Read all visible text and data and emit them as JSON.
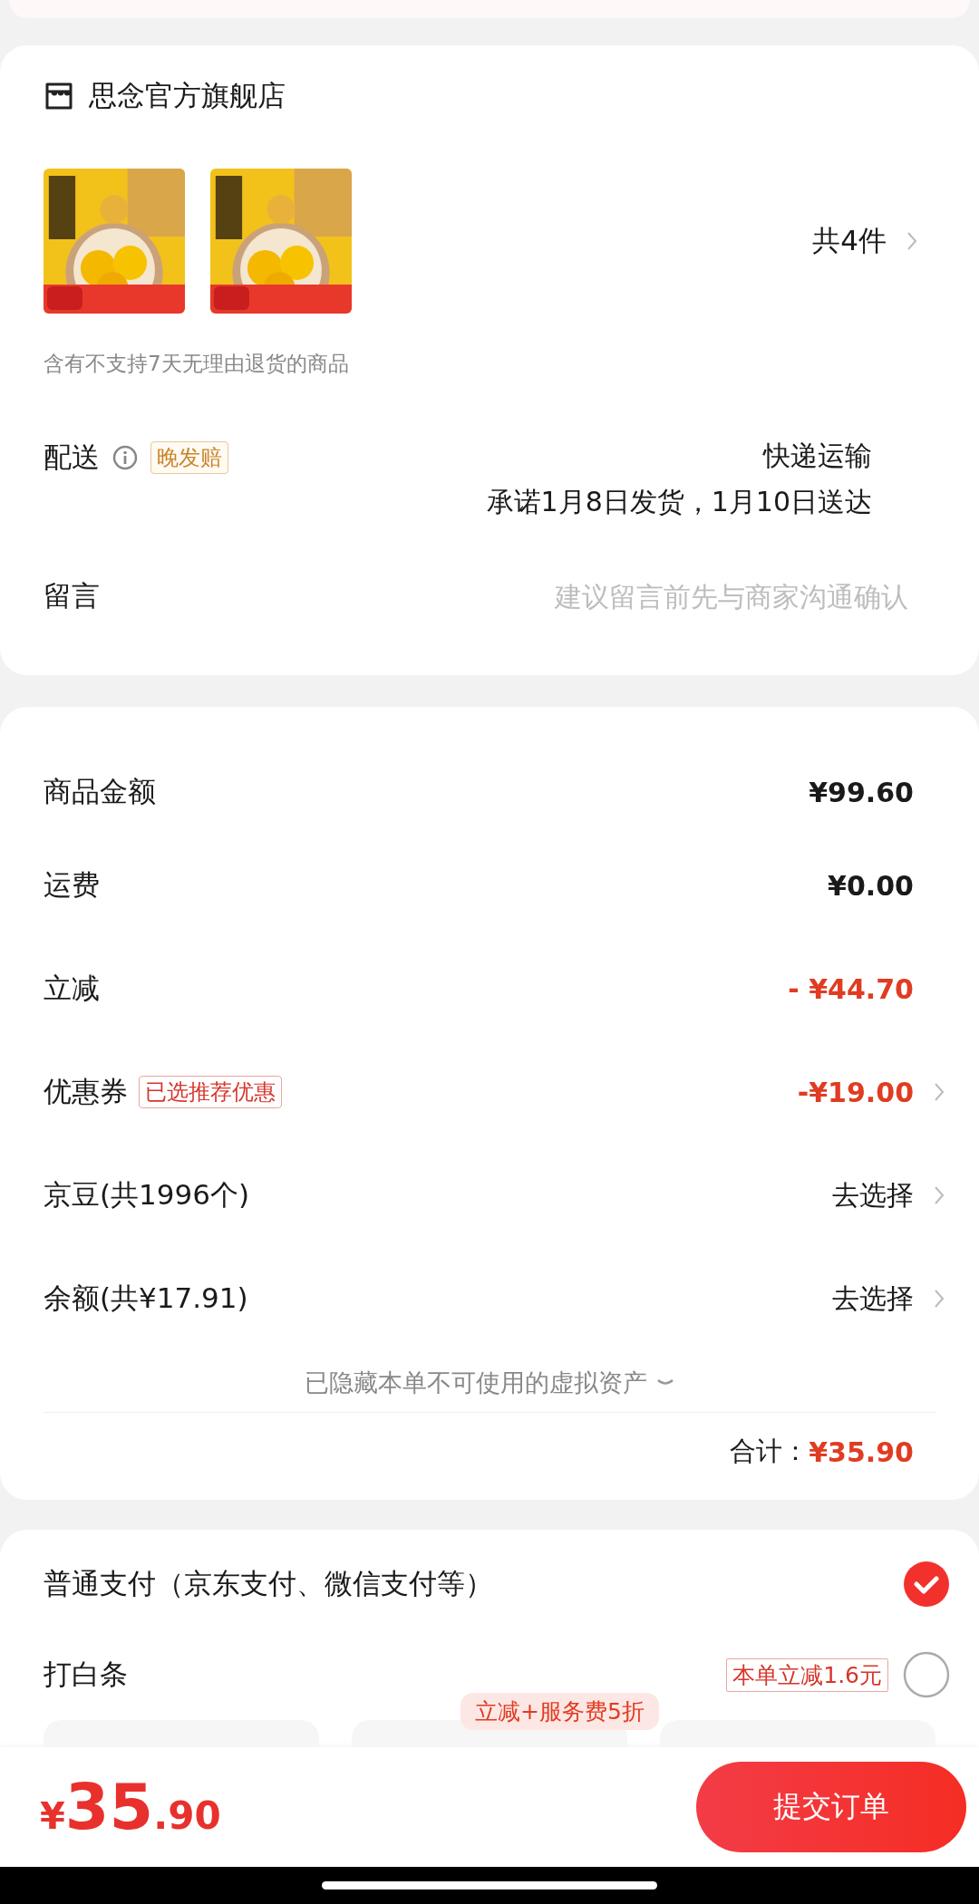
{
  "store": {
    "name": "思念官方旗舰店",
    "count": "共4件",
    "notice": "含有不支持7天无理由退货的商品",
    "delivery": {
      "label": "配送",
      "tag": "晚发赔",
      "method": "快递运输",
      "promise": "承诺1月8日发货，1月10日送达"
    },
    "message": {
      "label": "留言",
      "placeholder": "建议留言前先与商家沟通确认"
    }
  },
  "summary": {
    "rows": [
      {
        "label": "商品金额",
        "value": "¥99.60",
        "kind": "amount",
        "link": false
      },
      {
        "label": "运费",
        "value": "¥0.00",
        "kind": "amount",
        "link": false
      },
      {
        "label": "立减",
        "value": "- ¥44.70",
        "kind": "discount",
        "link": false
      },
      {
        "label": "优惠券",
        "tag": "已选推荐优惠",
        "value": "-¥19.00",
        "kind": "discount",
        "link": true
      },
      {
        "label": "京豆(共1996个)",
        "value": "去选择",
        "kind": "choose",
        "link": true
      },
      {
        "label": "余额(共¥17.91)",
        "value": "去选择",
        "kind": "choose",
        "link": true
      }
    ],
    "hidden_note": "已隐藏本单不可使用的虚拟资产",
    "total_label": "合计：",
    "total": "¥35.90"
  },
  "payment": {
    "options": [
      {
        "label": "普通支付（京东支付、微信支付等）",
        "selected": true
      },
      {
        "label": "打白条",
        "tag": "本单立减1.6元",
        "selected": false
      }
    ],
    "promo_badge": "立减+服务费5折"
  },
  "footer": {
    "currency": "¥",
    "amount": "35",
    "decimals": ".90",
    "submit": "提交订单"
  }
}
